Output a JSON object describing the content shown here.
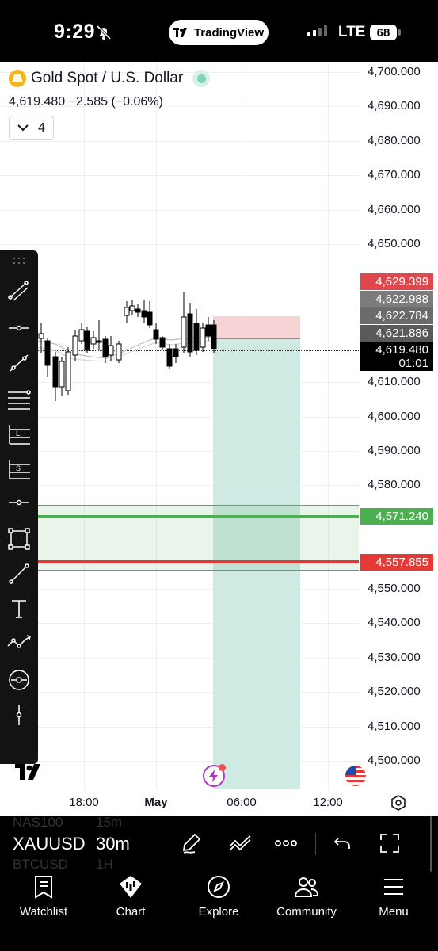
{
  "status_bar": {
    "time": "9:29",
    "app_pill": "TradingView",
    "network": "LTE",
    "battery": "68"
  },
  "symbol": {
    "title": "Gold Spot / U.S. Dollar",
    "quote": "4,619.480  −2.585  (−0.06%)",
    "indicators_count": "4"
  },
  "price_scale": {
    "labels": [
      "4,700.000",
      "4,690.000",
      "4,680.000",
      "4,670.000",
      "4,660.000",
      "4,650.000",
      "4,610.000",
      "4,600.000",
      "4,590.000",
      "4,580.000",
      "4,550.000",
      "4,540.000",
      "4,530.000",
      "4,520.000",
      "4,510.000",
      "4,500.000"
    ],
    "badge_stop": "4,629.399",
    "badge_a": "4,622.988",
    "badge_b": "4,622.784",
    "badge_c": "4,621.886",
    "badge_current": "4,619.480",
    "badge_countdown": "01:01",
    "badge_green_line": "4,571.240",
    "badge_red_line": "4,557.855"
  },
  "time_scale": {
    "labels": [
      "18:00",
      "May",
      "06:00",
      "12:00"
    ]
  },
  "toolbar_icons": [
    "drag-handle-icon",
    "trend-line-tools-icon",
    "horizontal-ray-icon",
    "trend-angle-icon",
    "fib-retracement-icon",
    "long-position-icon",
    "short-position-icon",
    "horizontal-line-icon",
    "rectangle-icon",
    "line-segment-icon",
    "text-icon",
    "pattern-icon",
    "magnet-icon",
    "vertical-line-icon"
  ],
  "symbol_bar": {
    "ghost_above": "NAS100",
    "ghost_above_int": "15m",
    "symbol": "XAUUSD",
    "interval": "30m",
    "ghost_below": "BTCUSD",
    "ghost_below_int": "1H"
  },
  "nav": {
    "watchlist": "Watchlist",
    "chart": "Chart",
    "explore": "Explore",
    "community": "Community",
    "menu": "Menu"
  },
  "colors": {
    "up_candle": "#ffffff",
    "down_candle": "#000000",
    "stop_zone": "#f7d3d6",
    "target_zone": "#cfe9e3",
    "green_line": "#4caf50",
    "red_line": "#e53935",
    "badge_red": "#e0474c",
    "badge_gray": "#7b7b7b",
    "badge_green": "#4caf50"
  }
}
